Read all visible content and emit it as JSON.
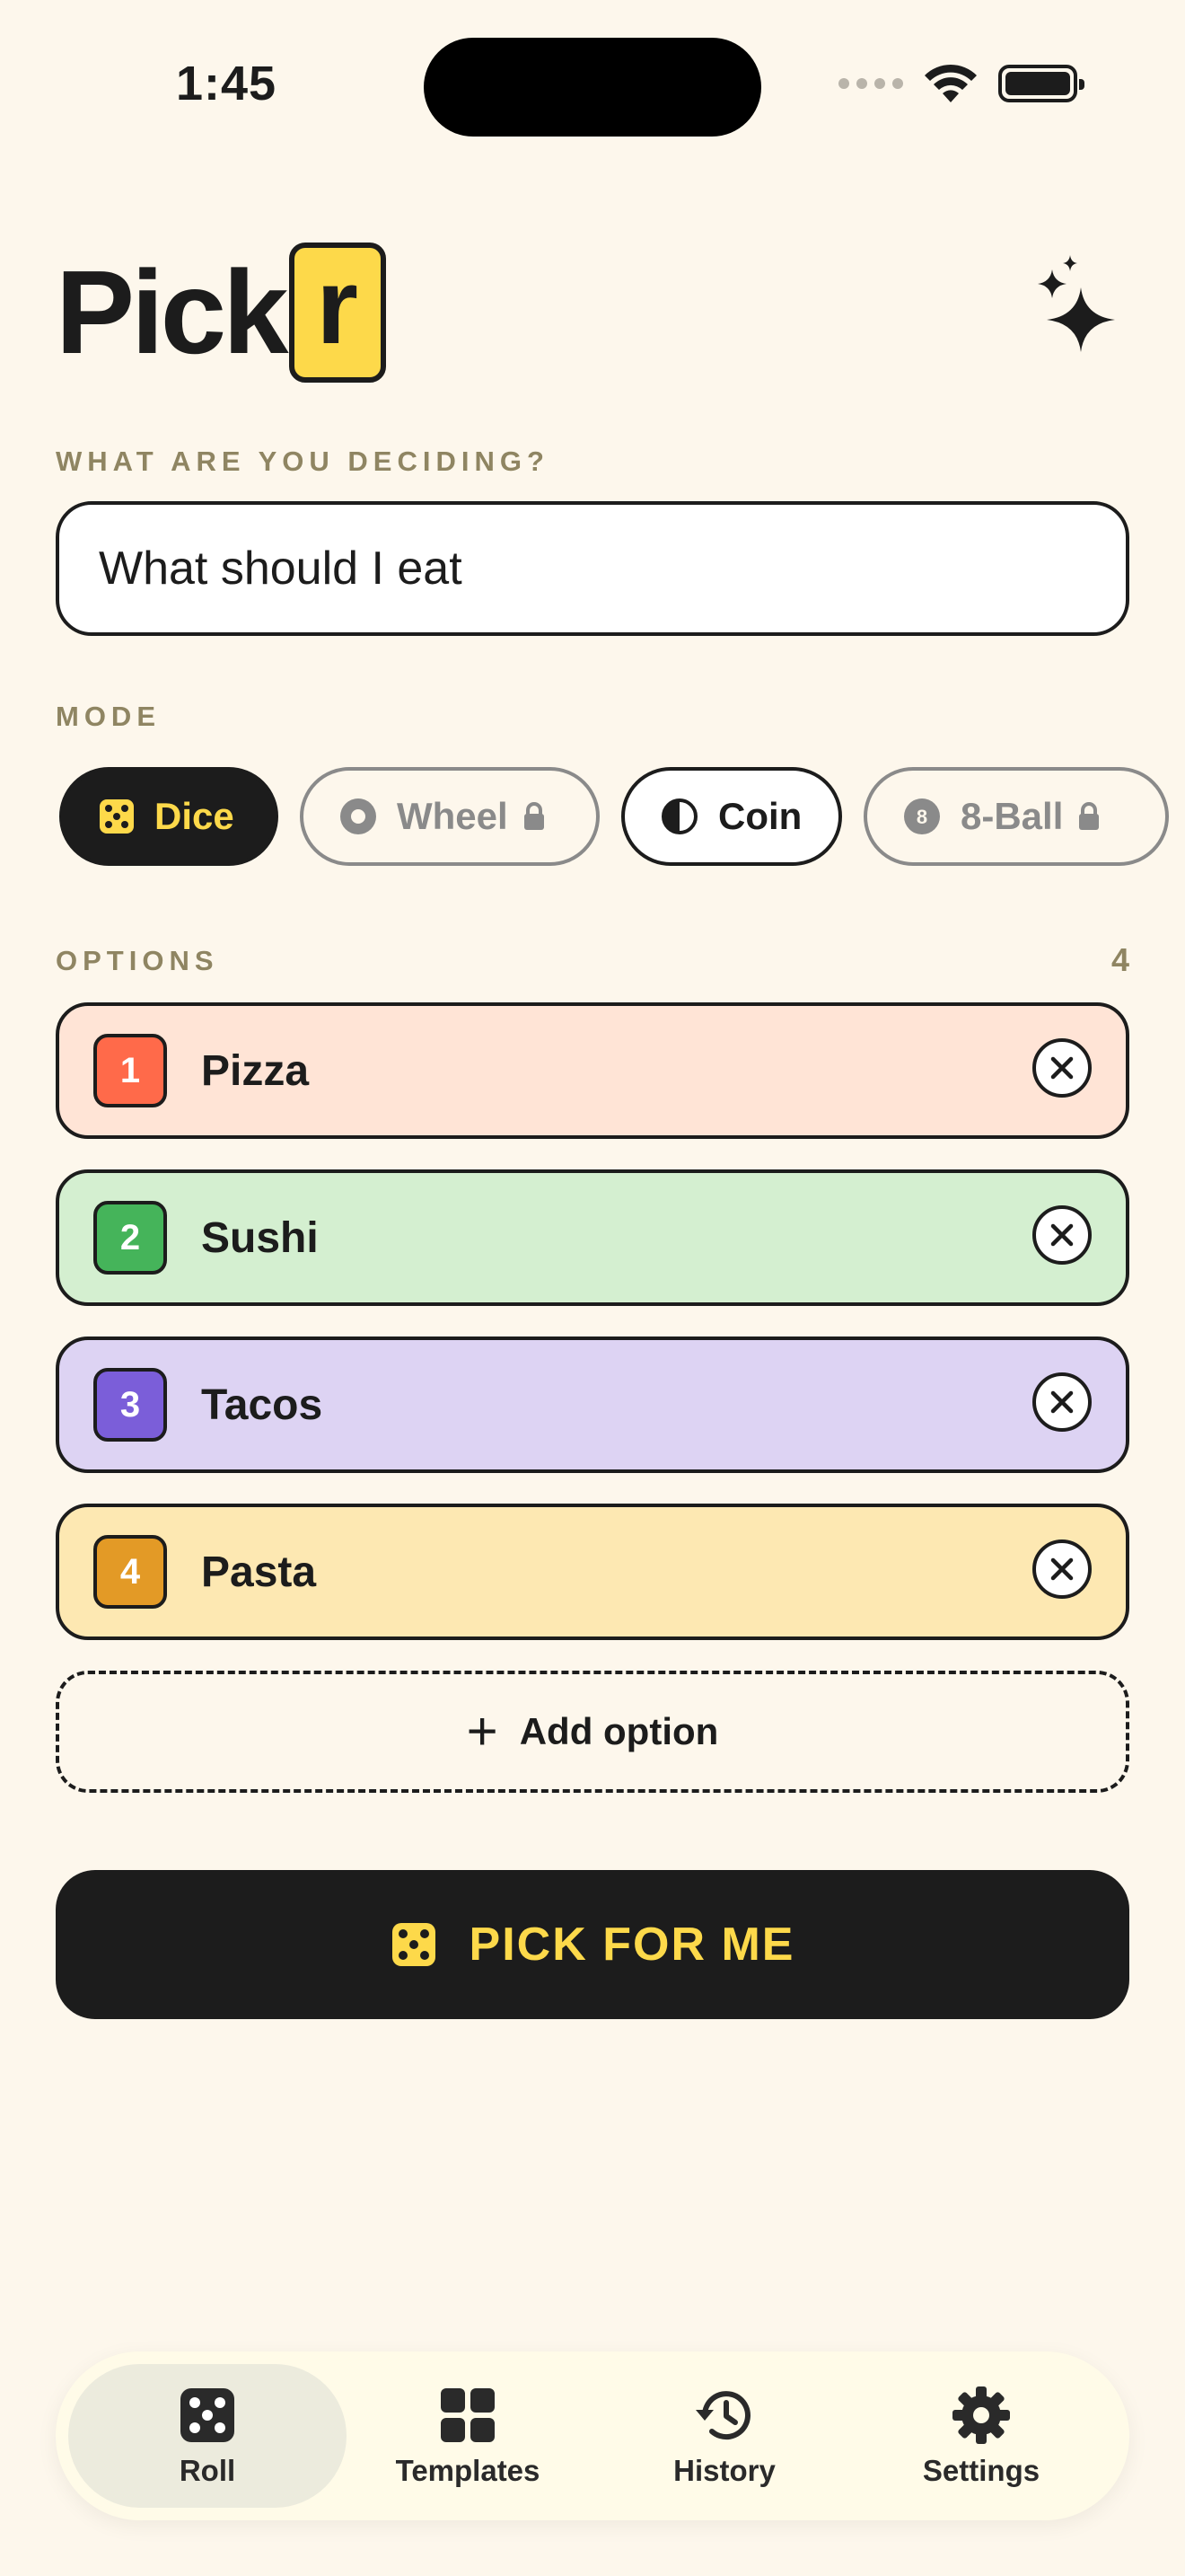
{
  "status_bar": {
    "time": "1:45"
  },
  "header": {
    "logo_main": "Pick",
    "logo_boxed": "r"
  },
  "decision": {
    "label": "WHAT ARE YOU DECIDING?",
    "value": "What should I eat"
  },
  "mode": {
    "label": "MODE",
    "chips": [
      {
        "label": "Dice",
        "icon": "dice-icon",
        "state": "selected"
      },
      {
        "label": "Wheel",
        "icon": "wheel-icon",
        "state": "locked"
      },
      {
        "label": "Coin",
        "icon": "coin-icon",
        "state": "unselected"
      },
      {
        "label": "8-Ball",
        "icon": "eight-ball-icon",
        "state": "locked"
      }
    ]
  },
  "options": {
    "label": "OPTIONS",
    "count": "4",
    "items": [
      {
        "number": "1",
        "label": "Pizza",
        "bg": "#ffe4d6",
        "badge": "#ff6a4a"
      },
      {
        "number": "2",
        "label": "Sushi",
        "bg": "#d4efd0",
        "badge": "#45b45a"
      },
      {
        "number": "3",
        "label": "Tacos",
        "bg": "#ddd3f3",
        "badge": "#7b5ed9"
      },
      {
        "number": "4",
        "label": "Pasta",
        "bg": "#fde8b2",
        "badge": "#e39a26"
      }
    ],
    "add_label": "Add option"
  },
  "pick_button": {
    "label": "PICK FOR ME"
  },
  "tabbar": {
    "tabs": [
      {
        "label": "Roll",
        "icon": "dice-icon",
        "active": true
      },
      {
        "label": "Templates",
        "icon": "grid-icon",
        "active": false
      },
      {
        "label": "History",
        "icon": "history-icon",
        "active": false
      },
      {
        "label": "Settings",
        "icon": "gear-icon",
        "active": false
      }
    ]
  },
  "colors": {
    "background": "#fdf7ec",
    "accent": "#fdd94a",
    "ink": "#1c1c1c"
  }
}
